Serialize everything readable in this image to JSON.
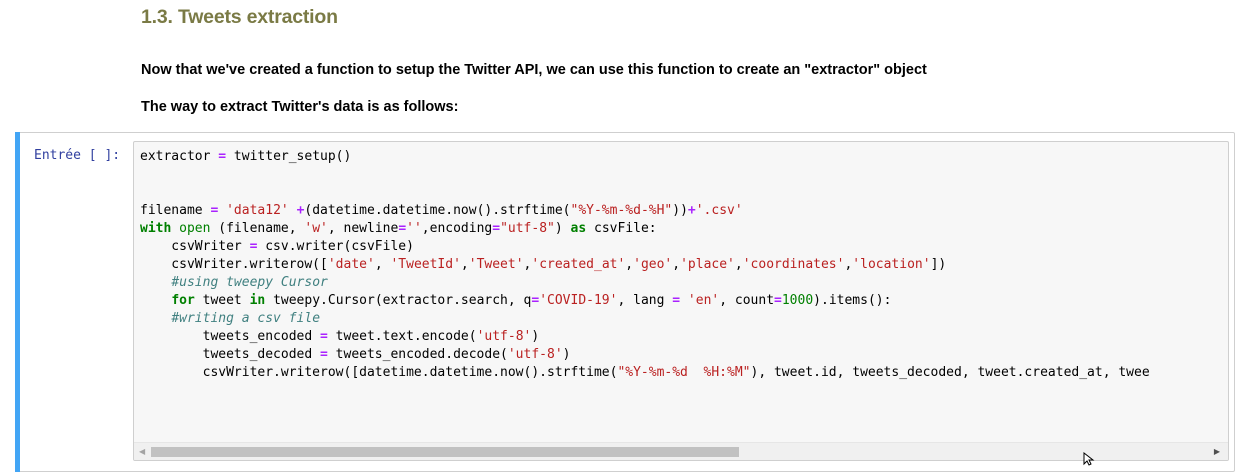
{
  "markdown": {
    "heading": "1.3. Tweets extraction",
    "para1": "Now that we've created a function to setup the Twitter API, we can use this function to create an \"extractor\" object",
    "para2": "The way to extract Twitter's data is as follows:"
  },
  "cell": {
    "prompt": "Entrée [ ]:",
    "code_lines": [
      "extractor = twitter_setup()",
      "",
      "",
      "filename = 'data12' +(datetime.datetime.now().strftime(\"%Y-%m-%d-%H\"))+'.csv'",
      "with open (filename, 'w', newline='',encoding=\"utf-8\") as csvFile:",
      "    csvWriter = csv.writer(csvFile)",
      "    csvWriter.writerow(['date', 'TweetId','Tweet','created_at','geo','place','coordinates','location'])",
      "    #using tweepy Cursor",
      "    for tweet in tweepy.Cursor(extractor.search, q='COVID-19', lang = 'en', count=1000).items():",
      "    #writing a csv file",
      "        tweets_encoded = tweet.text.encode('utf-8')",
      "        tweets_decoded = tweets_encoded.decode('utf-8')",
      "        csvWriter.writerow([datetime.datetime.now().strftime(\"%Y-%m-%d  %H:%M\"), tweet.id, tweets_decoded, tweet.created_at, twee"
    ]
  },
  "icons": {
    "scroll_left": "scroll-left-arrow-icon",
    "scroll_right": "scroll-right-arrow-icon",
    "cursor": "mouse-cursor-icon"
  },
  "colors": {
    "heading": "#7a7a45",
    "cell_selected_bar": "#42a5f5",
    "prompt": "#303f9f",
    "editor_background": "#f7f7f7"
  }
}
